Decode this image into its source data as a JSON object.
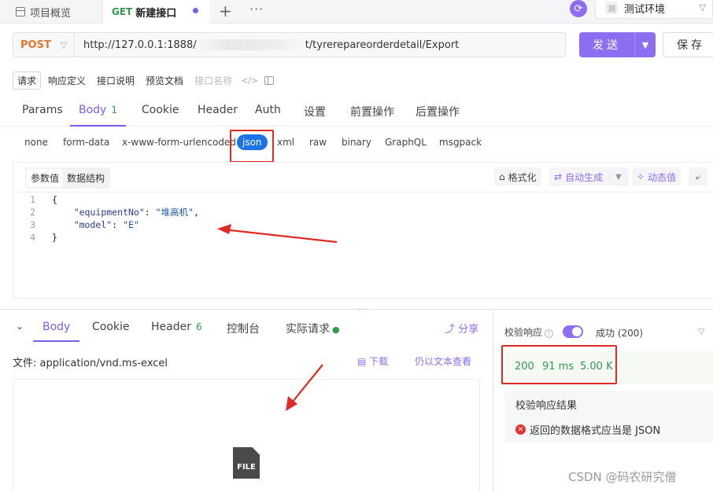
{
  "top_tabs": {
    "overview_label": "项目概览",
    "active_method": "GET",
    "active_label": "新建接口",
    "plus": "+",
    "more": "···"
  },
  "environment": {
    "badge": "测",
    "label": "测试环境"
  },
  "request": {
    "method": "POST",
    "url_prefix": "http://127.0.0.1:1888/",
    "url_suffix": "t/tyrerepareorderdetail/Export",
    "send_label": "发送",
    "save_label": "保存"
  },
  "doc_tabs": {
    "items": [
      "请求",
      "响应定义",
      "接口说明",
      "预览文档"
    ],
    "name_placeholder": "接口名称",
    "code_icon": "</>"
  },
  "param_tabs": {
    "items": [
      "Params",
      "Body",
      "Cookie",
      "Header",
      "Auth",
      "设置",
      "前置操作",
      "后置操作"
    ],
    "body_count": "1"
  },
  "body_types": [
    "none",
    "form-data",
    "x-www-form-urlencoded",
    "json",
    "xml",
    "raw",
    "binary",
    "GraphQL",
    "msgpack"
  ],
  "editor": {
    "sub_tabs": [
      "参数值",
      "数据结构"
    ],
    "format_label": "格式化",
    "autogen_label": "自动生成",
    "dynamic_label": "动态值",
    "lines": [
      {
        "n": "1",
        "key": "",
        "value": "",
        "raw": "{"
      },
      {
        "n": "2",
        "key": "\"equipmentNo\"",
        "value": "\"堆高机\"",
        "raw": ""
      },
      {
        "n": "3",
        "key": "\"model\"",
        "value": "\"E\"",
        "raw": ""
      },
      {
        "n": "4",
        "key": "",
        "value": "",
        "raw": "}"
      }
    ]
  },
  "response": {
    "tabs": [
      "Body",
      "Cookie",
      "Header",
      "控制台",
      "实际请求"
    ],
    "header_count": "6",
    "share_label": "分享",
    "file_label": "文件: application/vnd.ms-excel",
    "download_label": "下载",
    "text_view_label": "仍以文本查看",
    "file_icon_text": "FILE"
  },
  "validation": {
    "label": "校验响应",
    "status_label": "成功 (200)",
    "code": "200",
    "time": "91 ms",
    "size": "5.00 K",
    "result_title": "校验响应结果",
    "result_message": "返回的数据格式应当是 JSON"
  },
  "watermark": "CSDN @码农研究僧",
  "colors": {
    "accent": "#8d6df1",
    "method_post": "#e8752c",
    "success": "#2e9e4a",
    "json_pill": "#1a73e8",
    "annotation_red": "#e02a25"
  }
}
